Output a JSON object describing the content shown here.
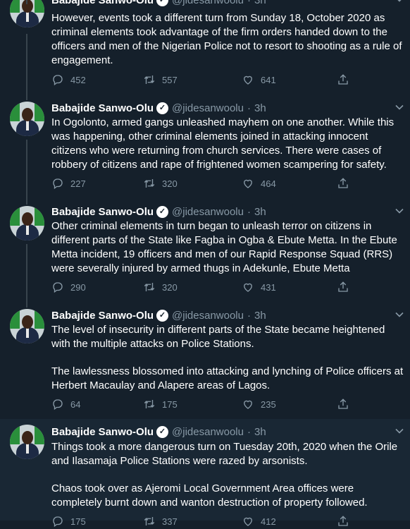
{
  "author": {
    "name": "Babajide Sanwo-Olu",
    "handle": "@jidesanwoolu",
    "time": "3h",
    "separator": "·"
  },
  "tweets": [
    {
      "paragraphs": [
        "However, events took a different turn from Sunday 18, October 2020 as criminal elements took advantage of the firm orders handed down to the officers and men of the Nigerian Police not to resort to shooting as a rule of engagement."
      ],
      "replies": "452",
      "retweets": "557",
      "likes": "641"
    },
    {
      "paragraphs": [
        "In Ogolonto, armed gangs unleashed mayhem on one another. While this was happening, other criminal elements joined in attacking innocent citizens who were returning from church services. There were cases of robbery of citizens and rape of frightened women scampering for safety."
      ],
      "replies": "227",
      "retweets": "320",
      "likes": "464"
    },
    {
      "paragraphs": [
        "Other criminal elements in turn began to unleash terror on citizens in different parts of the State like Fagba in Ogba & Ebute Metta. In the Ebute Metta incident, 19 officers and men of our Rapid Response Squad (RRS) were severally injured by armed thugs in Adekunle, Ebute Metta"
      ],
      "replies": "290",
      "retweets": "320",
      "likes": "431"
    },
    {
      "paragraphs": [
        "The level of insecurity in different parts of the State became heightened with the multiple attacks on Police Stations.",
        "The lawlessness blossomed into attacking and lynching of Police officers at Herbert Macaulay and Alapere areas of Lagos."
      ],
      "replies": "64",
      "retweets": "175",
      "likes": "235"
    },
    {
      "paragraphs": [
        "Things took a more dangerous turn on Tuesday 20th, 2020 when the Orile and Ilasamaja Police Stations were razed by arsonists.",
        "Chaos took over as Ajeromi Local Government Area offices were completely burnt down and wanton destruction of property followed."
      ],
      "replies": "175",
      "retweets": "337",
      "likes": "412"
    }
  ],
  "colors": {
    "background": "#15202b",
    "highlight": "#192734",
    "muted": "#8899a6",
    "thread_line": "#38444d"
  },
  "icons": [
    "reply-icon",
    "retweet-icon",
    "like-icon",
    "share-icon",
    "verified-badge-icon",
    "chevron-down-icon"
  ]
}
